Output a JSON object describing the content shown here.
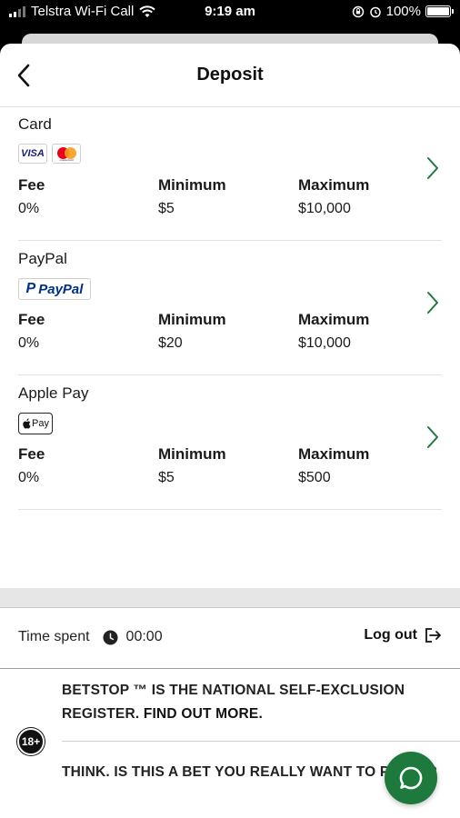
{
  "status_bar": {
    "carrier": "Telstra Wi-Fi Call",
    "time": "9:19 am",
    "battery": "100%",
    "battery_level": 1.0
  },
  "header": {
    "title": "Deposit",
    "back_icon": "chevron-left-icon"
  },
  "methods": [
    {
      "name": "Card",
      "logos": [
        "VISA",
        "mastercard"
      ],
      "fee_label": "Fee",
      "fee": "0%",
      "min_label": "Minimum",
      "min": "$5",
      "max_label": "Maximum",
      "max": "$10,000"
    },
    {
      "name": "PayPal",
      "logos": [
        "PayPal"
      ],
      "fee_label": "Fee",
      "fee": "0%",
      "min_label": "Minimum",
      "min": "$20",
      "max_label": "Maximum",
      "max": "$10,000"
    },
    {
      "name": "Apple Pay",
      "logos": [
        "Pay"
      ],
      "fee_label": "Fee",
      "fee": "0%",
      "min_label": "Minimum",
      "min": "$5",
      "max_label": "Maximum",
      "max": "$500"
    }
  ],
  "footer": {
    "time_spent_label": "Time spent",
    "time_spent_value": "00:00",
    "logout_label": "Log out",
    "betstop_text": "BETSTOP ™ IS THE NATIONAL SELF-EXCLUSION REGISTER.",
    "find_out_more": "FIND OUT MORE.",
    "think_text": "THINK. IS THIS A BET YOU REALLY WANT TO PLACE?",
    "age_badge": "18+"
  },
  "colors": {
    "accent_green": "#1e7a3c",
    "chevron_green": "#1e7a3c",
    "text": "#1a1a1a"
  }
}
